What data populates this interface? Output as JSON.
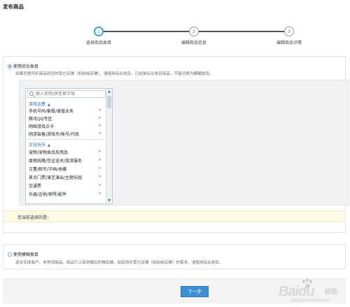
{
  "page_title": "发布商品",
  "stepper": {
    "steps": [
      {
        "num": "1",
        "label": "选择商品类目",
        "active": true
      },
      {
        "num": "2",
        "label": "编辑商品信息",
        "active": false
      },
      {
        "num": "3",
        "label": "编辑商品详情",
        "active": false
      }
    ]
  },
  "option_general": {
    "title": "使用综合类目",
    "desc": "如果您想同步商品到您的其它店铺（如拍拍店铺），请使用综合类目。已经是综合类目商品，不能切换为模糊类目。",
    "checked": true
  },
  "category_selector": {
    "search_placeholder": "输入名称/拼音首字母",
    "groups": [
      {
        "label": "游戏话费",
        "items": [
          "手机号码/套餐/增值业务",
          "腾讯QQ专区",
          "网络游戏点卡",
          "网游装备/游戏币/帐号/代练"
        ]
      },
      {
        "label": "文化玩乐",
        "items": [
          "宠物/宠物食品及用品",
          "度假线路/签证送关/旅游服务",
          "古董/邮币/字画/收藏",
          "景点门票/演艺演出/主题乐园",
          "交通票",
          "乐器/吉他/钢琴/配件"
        ]
      }
    ]
  },
  "selected": {
    "label": "您当前选择的是："
  },
  "option_fuzzy": {
    "title": "使用模糊类目",
    "desc": "适合实体商户、非常规商品。商品只上架到微店的微店铺，如有同步其它店铺（如拍拍店铺）的需求，请使用综合类目。",
    "checked": false
  },
  "footer": {
    "next_label": "下一步"
  },
  "watermark": {
    "brand": "Baidu",
    "cn": "经验",
    "url": "jingyan.baidu.com"
  },
  "colors": {
    "accent": "#40a7c9",
    "button": "#3d8fd1",
    "group_link": "#2d6fb0",
    "selected_bg": "#fdfae6"
  }
}
